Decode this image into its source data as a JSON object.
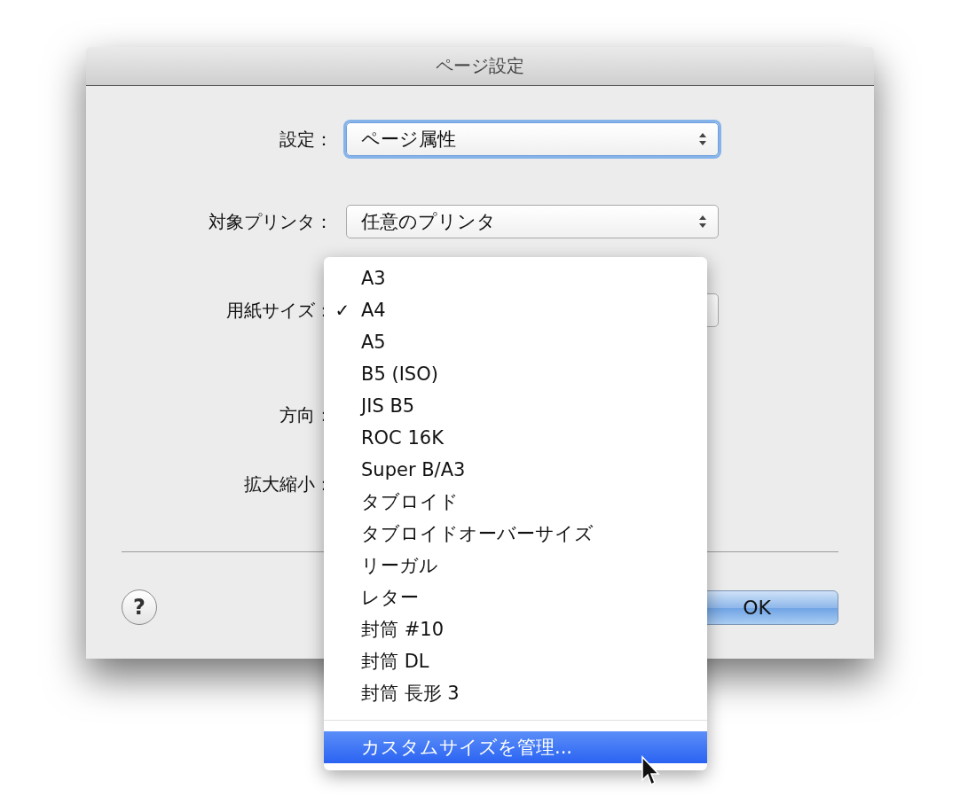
{
  "window": {
    "title": "ページ設定"
  },
  "form": {
    "rows": [
      {
        "label": "設定：",
        "kind": "popup",
        "value": "ページ属性",
        "focused": true
      },
      {
        "label": "対象プリンタ：",
        "kind": "popup",
        "value": "任意のプリンタ",
        "focused": false
      },
      {
        "label": "用紙サイズ：",
        "kind": "covered_popup"
      },
      {
        "label": "方向：",
        "kind": "covered"
      },
      {
        "label": "拡大縮小：",
        "kind": "covered"
      }
    ]
  },
  "help_button": "?",
  "buttons": [
    {
      "label": "OK",
      "kind": "default"
    }
  ],
  "menu": {
    "check_glyph": "✓",
    "items": [
      {
        "label": "A3",
        "checked": false
      },
      {
        "label": "A4",
        "checked": true
      },
      {
        "label": "A5",
        "checked": false
      },
      {
        "label": "B5 (ISO)",
        "checked": false
      },
      {
        "label": "JIS B5",
        "checked": false
      },
      {
        "label": "ROC 16K",
        "checked": false
      },
      {
        "label": "Super B/A3",
        "checked": false
      },
      {
        "label": "タブロイド",
        "checked": false
      },
      {
        "label": "タブロイドオーバーサイズ",
        "checked": false
      },
      {
        "label": "リーガル",
        "checked": false
      },
      {
        "label": "レター",
        "checked": false
      },
      {
        "label": "封筒 #10",
        "checked": false
      },
      {
        "label": "封筒 DL",
        "checked": false
      },
      {
        "label": "封筒 長形 3",
        "checked": false
      }
    ],
    "actions": [
      {
        "label": "カスタムサイズを管理...",
        "selected": true
      }
    ]
  }
}
